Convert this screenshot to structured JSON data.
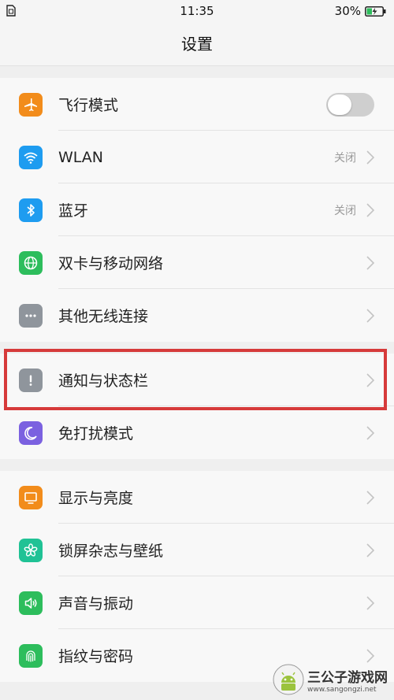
{
  "statusbar": {
    "time": "11:35",
    "battery_text": "30%"
  },
  "title": "设置",
  "groups": [
    [
      {
        "label": "飞行模式",
        "icon": "airplane-icon",
        "color": "#f28c1b",
        "control": "toggle",
        "toggle_on": false
      },
      {
        "label": "WLAN",
        "icon": "wifi-icon",
        "color": "#1e9cf0",
        "value": "关闭"
      },
      {
        "label": "蓝牙",
        "icon": "bluetooth-icon",
        "color": "#1e9cf0",
        "value": "关闭"
      },
      {
        "label": "双卡与移动网络",
        "icon": "globe-icon",
        "color": "#2dbd5c"
      },
      {
        "label": "其他无线连接",
        "icon": "more-icon",
        "color": "#8f959c"
      }
    ],
    [
      {
        "label": "通知与状态栏",
        "icon": "notification-icon",
        "color": "#8f959c"
      },
      {
        "label": "免打扰模式",
        "icon": "moon-icon",
        "color": "#7b61e0"
      }
    ],
    [
      {
        "label": "显示与亮度",
        "icon": "display-icon",
        "color": "#f28c1b"
      },
      {
        "label": "锁屏杂志与壁纸",
        "icon": "flower-icon",
        "color": "#20c295"
      },
      {
        "label": "声音与振动",
        "icon": "speaker-icon",
        "color": "#2dbd5c"
      },
      {
        "label": "指纹与密码",
        "icon": "fingerprint-icon",
        "color": "#2dbd5c"
      }
    ]
  ],
  "watermark": {
    "title": "三公子游戏网",
    "url": "www.sangongzi.net"
  },
  "highlight_color": "#d63a3a"
}
